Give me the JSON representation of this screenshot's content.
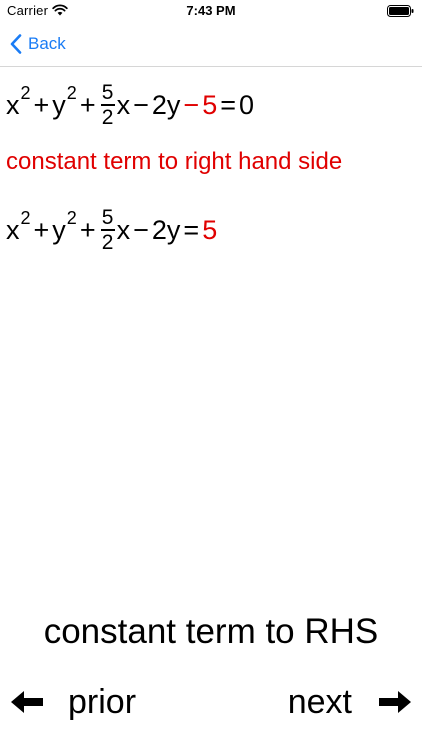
{
  "status_bar": {
    "carrier": "Carrier",
    "time": "7:43 PM",
    "wifi_icon": "wifi-icon",
    "battery_icon": "battery-icon"
  },
  "nav": {
    "back_label": "Back",
    "back_icon": "chevron-left-icon",
    "accent_color": "#1a7cf5"
  },
  "math": {
    "line1": {
      "x": "x",
      "exp_x": "2",
      "plus1": "+",
      "y": "y",
      "exp_y": "2",
      "plus2": "+",
      "frac_num": "5",
      "frac_den": "2",
      "x2": "x",
      "minus1": "−",
      "coef_y": "2y",
      "minus2": "−",
      "const": "5",
      "equals": "=",
      "rhs": "0"
    },
    "line2": {
      "x": "x",
      "exp_x": "2",
      "plus1": "+",
      "y": "y",
      "exp_y": "2",
      "plus2": "+",
      "frac_num": "5",
      "frac_den": "2",
      "x2": "x",
      "minus1": "−",
      "coef_y": "2y",
      "equals": "=",
      "rhs": "5"
    }
  },
  "note": "constant term to right hand side",
  "step_title": "constant term to RHS",
  "footer": {
    "prior_label": "prior",
    "next_label": "next",
    "prior_icon": "arrow-left-icon",
    "next_icon": "arrow-right-icon"
  },
  "colors": {
    "highlight": "#e00000",
    "text": "#000000"
  }
}
